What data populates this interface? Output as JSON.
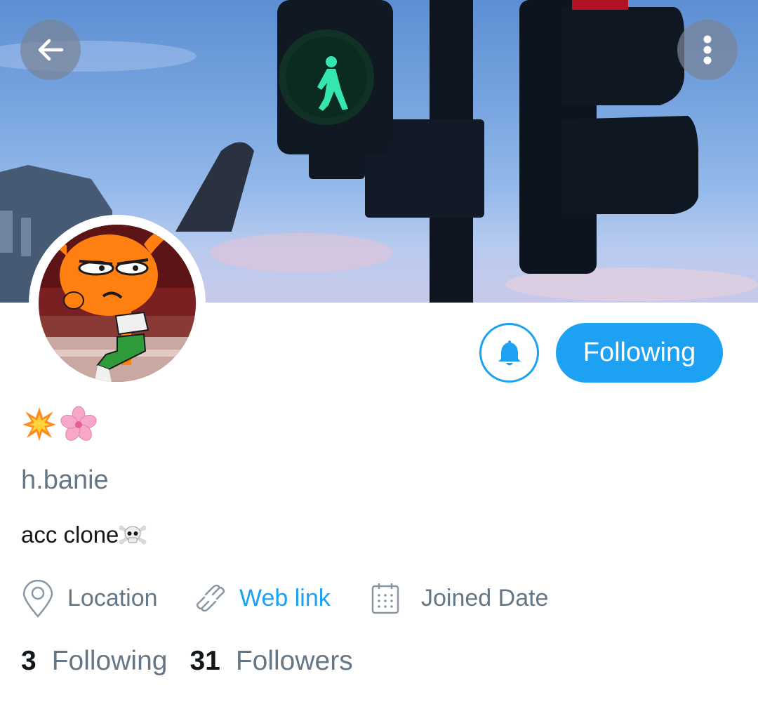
{
  "header": {
    "back_icon": "arrow-left-icon",
    "more_icon": "more-vertical-icon"
  },
  "profile": {
    "display_name_emojis": [
      "collision-emoji",
      "cherry-blossom-emoji"
    ],
    "username": "h.banie",
    "bio": "acc clone",
    "bio_emoji": "skull-crossbones-emoji",
    "location_label": "Location",
    "weblink_label": "Web link",
    "joined_label": "Joined Date"
  },
  "actions": {
    "bell_icon": "bell-icon",
    "following_label": "Following"
  },
  "stats": {
    "following_count": "3",
    "following_label": "Following",
    "followers_count": "31",
    "followers_label": "Followers"
  },
  "colors": {
    "accent": "#1da1f2",
    "secondary_text": "#657786",
    "primary_text": "#14171a"
  }
}
